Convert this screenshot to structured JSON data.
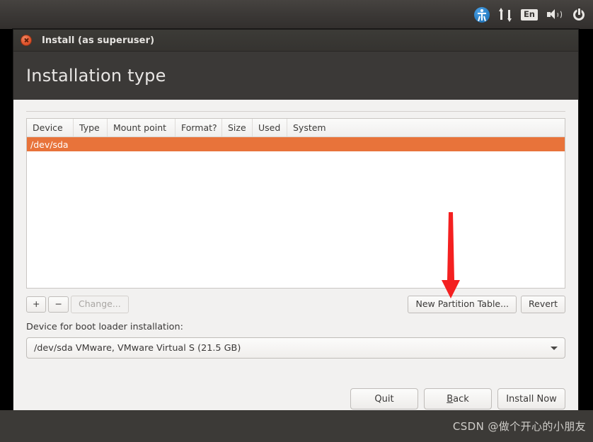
{
  "top_panel": {
    "indicators": [
      {
        "name": "accessibility-icon",
        "label": ""
      },
      {
        "name": "network-icon",
        "label": ""
      },
      {
        "name": "keyboard-layout-indicator",
        "label": "En"
      },
      {
        "name": "volume-icon",
        "label": ""
      },
      {
        "name": "session-menu-icon",
        "label": ""
      }
    ]
  },
  "window": {
    "title": "Install (as superuser)",
    "close_tooltip": "Close",
    "page_title": "Installation type"
  },
  "partition_table": {
    "columns": [
      "Device",
      "Type",
      "Mount point",
      "Format?",
      "Size",
      "Used",
      "System"
    ],
    "rows": [
      {
        "device": "/dev/sda",
        "type": "",
        "mount_point": "",
        "format": "",
        "size": "",
        "used": "",
        "system": "",
        "selected": true
      }
    ]
  },
  "toolbar": {
    "add_label": "+",
    "remove_label": "−",
    "change_label": "Change...",
    "new_partition_table_label": "New Partition Table...",
    "revert_label": "Revert"
  },
  "bootloader": {
    "label": "Device for boot loader installation:",
    "selected_value": "/dev/sda VMware, VMware Virtual S (21.5 GB)",
    "options": [
      "/dev/sda VMware, VMware Virtual S (21.5 GB)"
    ]
  },
  "actions": {
    "quit_label": "Quit",
    "back_label_mnemonic": "B",
    "back_label_rest": "ack",
    "install_label": "Install Now"
  },
  "annotation": {
    "arrow_color": "#f42020",
    "points_to": "New Partition Table..."
  },
  "watermark": {
    "text": "CSDN @做个开心的小朋友"
  },
  "colors": {
    "selection_orange": "#e8733a",
    "panel_dark": "#3b3937",
    "window_bg": "#f2f1f0",
    "accent_red": "#f42020"
  }
}
